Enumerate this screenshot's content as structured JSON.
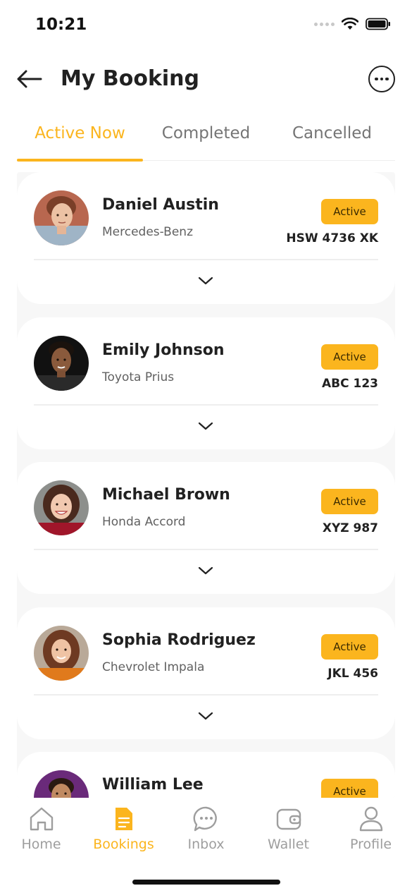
{
  "status_bar": {
    "time": "10:21"
  },
  "header": {
    "title": "My Booking"
  },
  "tabs": [
    {
      "label": "Active Now",
      "active": true
    },
    {
      "label": "Completed",
      "active": false
    },
    {
      "label": "Cancelled",
      "active": false
    }
  ],
  "bookings": [
    {
      "name": "Daniel Austin",
      "car": "Mercedes-Benz",
      "status": "Active",
      "plate": "HSW 4736 XK"
    },
    {
      "name": "Emily Johnson",
      "car": "Toyota Prius",
      "status": "Active",
      "plate": "ABC 123"
    },
    {
      "name": "Michael Brown",
      "car": "Honda Accord",
      "status": "Active",
      "plate": "XYZ 987"
    },
    {
      "name": "Sophia Rodriguez",
      "car": "Chevrolet Impala",
      "status": "Active",
      "plate": "JKL 456"
    },
    {
      "name": "William Lee",
      "car": "",
      "status": "Active",
      "plate": ""
    }
  ],
  "bottom_nav": [
    {
      "label": "Home",
      "icon": "home-icon",
      "active": false
    },
    {
      "label": "Bookings",
      "icon": "document-icon",
      "active": true
    },
    {
      "label": "Inbox",
      "icon": "chat-icon",
      "active": false
    },
    {
      "label": "Wallet",
      "icon": "wallet-icon",
      "active": false
    },
    {
      "label": "Profile",
      "icon": "person-icon",
      "active": false
    }
  ],
  "colors": {
    "accent": "#FBB51E",
    "text": "#212121",
    "muted": "#9E9E9E",
    "list_bg": "#F7F7F7"
  }
}
